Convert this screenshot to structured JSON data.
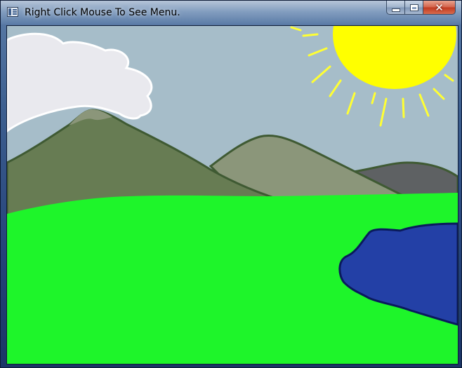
{
  "window": {
    "title": "Right Click Mouse To See Menu.",
    "icon": "app-window-icon"
  },
  "caption_buttons": {
    "minimize_icon": "minimize-icon",
    "maximize_icon": "maximize-icon",
    "close_icon": "close-icon",
    "close_glyph": "✕"
  },
  "scene": {
    "colors": {
      "sky": "#a6bdc9",
      "sun": "#ffff00",
      "sun_rays": "#ffff33",
      "cloud": "#e9e9ee",
      "cloud_outline": "#ffffff",
      "mountain_left": "#677c53",
      "mountain_middle": "#8b967a",
      "mountain_right": "#5e6163",
      "mountain_outline": "#3f5a33",
      "grass": "#1ef52a",
      "lake": "#2340a6",
      "lake_outline": "#0a1a5c"
    }
  }
}
